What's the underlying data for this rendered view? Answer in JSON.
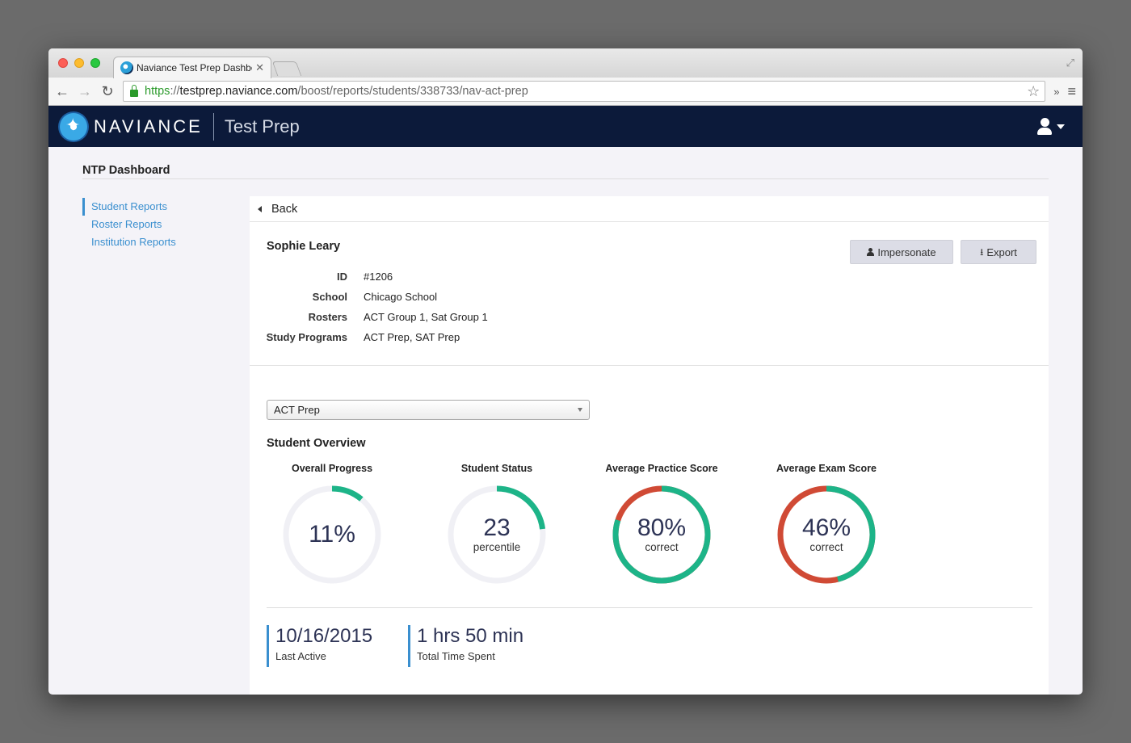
{
  "browser": {
    "tab_title": "Naviance Test Prep Dashbo",
    "url_scheme": "https",
    "url_sep": "://",
    "url_domain": "testprep.naviance.com",
    "url_path": "/boost/reports/students/338733/nav-act-prep"
  },
  "header": {
    "brand": "NAVIANCE",
    "product": "Test Prep"
  },
  "page": {
    "title": "NTP Dashboard"
  },
  "sidebar": {
    "items": [
      {
        "label": "Student Reports",
        "active": true
      },
      {
        "label": "Roster Reports",
        "active": false
      },
      {
        "label": "Institution Reports",
        "active": false
      }
    ]
  },
  "panel": {
    "back_label": "Back",
    "student_name": "Sophie Leary",
    "impersonate_label": "Impersonate",
    "export_label": "Export",
    "info": [
      {
        "key": "ID",
        "value": "#1206"
      },
      {
        "key": "School",
        "value": "Chicago School"
      },
      {
        "key": "Rosters",
        "value": "ACT Group 1, Sat Group 1"
      },
      {
        "key": "Study Programs",
        "value": "ACT Prep, SAT Prep"
      }
    ],
    "program_select": "ACT Prep",
    "overview_title": "Student Overview",
    "metrics": [
      {
        "label": "Overall Progress",
        "value": "11%",
        "sub": "",
        "fraction": 0.11,
        "mode": "progress"
      },
      {
        "label": "Student Status",
        "value": "23",
        "sub": "percentile",
        "fraction": 0.23,
        "mode": "progress"
      },
      {
        "label": "Average Practice Score",
        "value": "80%",
        "sub": "correct",
        "fraction": 0.8,
        "mode": "score"
      },
      {
        "label": "Average Exam Score",
        "value": "46%",
        "sub": "correct",
        "fraction": 0.46,
        "mode": "score"
      }
    ],
    "stats": [
      {
        "value": "10/16/2015",
        "label": "Last Active"
      },
      {
        "value": "1 hrs 50 min",
        "label": "Total Time Spent"
      }
    ]
  },
  "colors": {
    "accent": "#3a8fcf",
    "ring_green": "#1db488",
    "ring_red": "#d04a35",
    "ring_track": "#f0f0f5",
    "header_bg": "#0c1a3a"
  }
}
